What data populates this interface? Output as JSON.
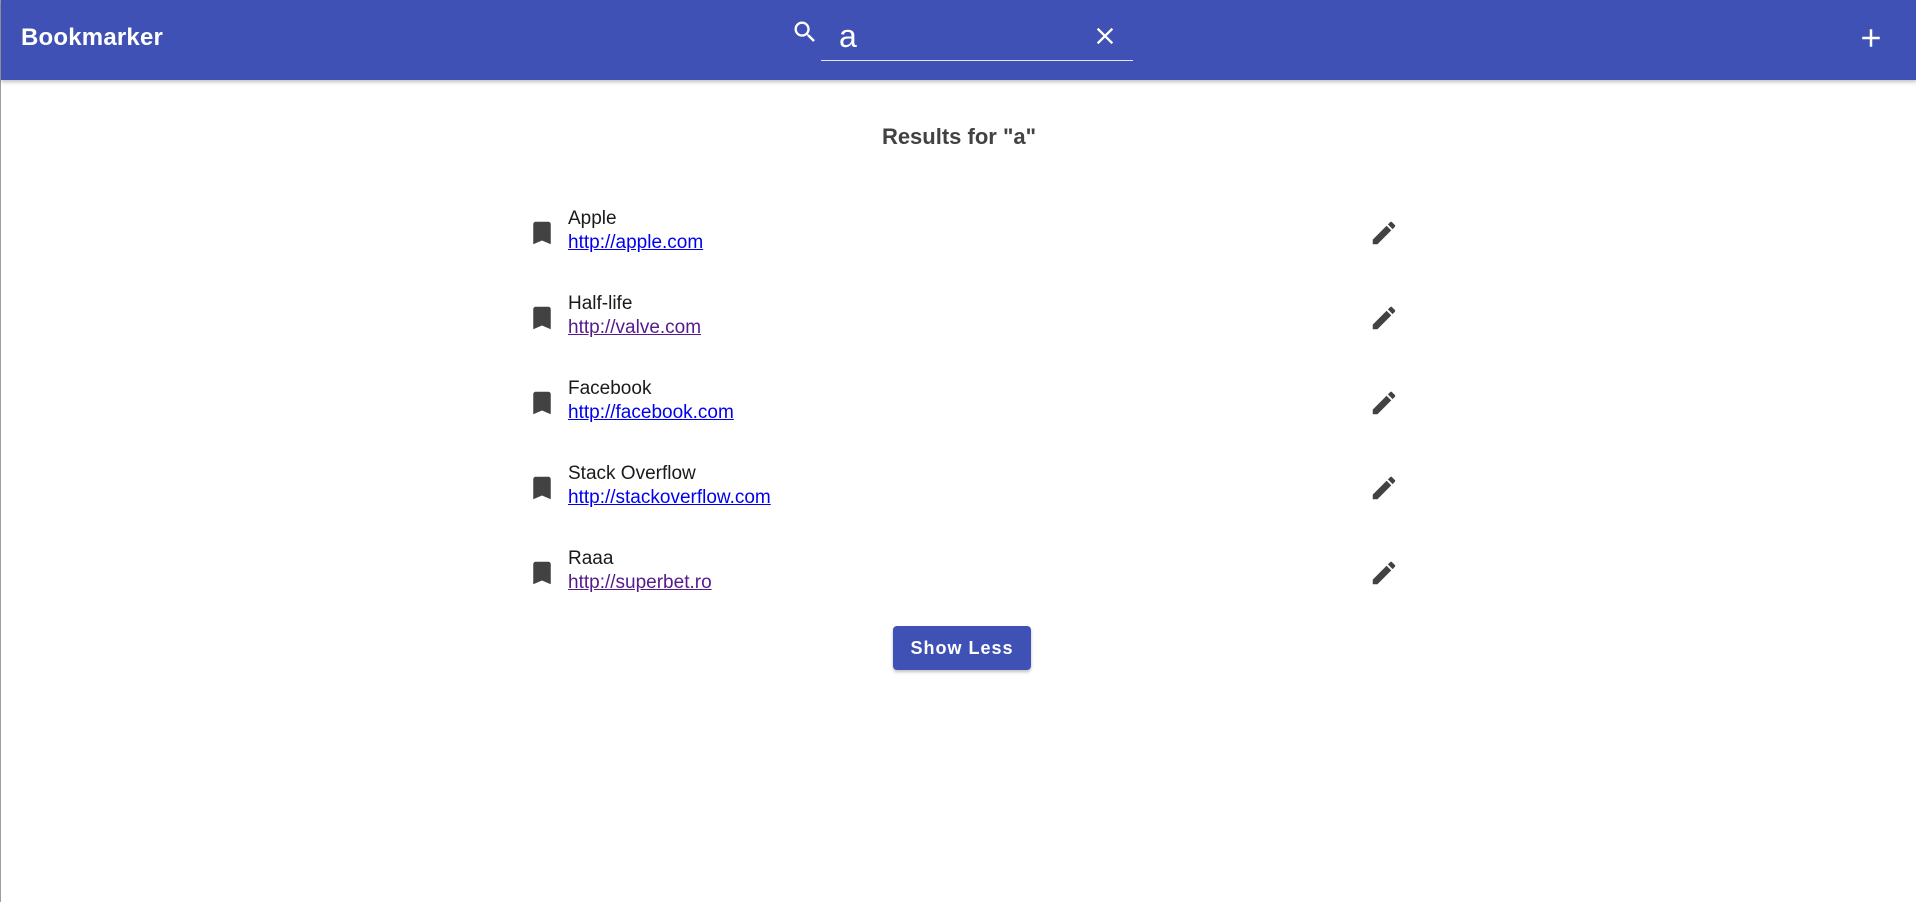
{
  "header": {
    "title": "Bookmarker",
    "search_value": "a",
    "icons": {
      "search": "search-icon",
      "clear": "close-icon",
      "add": "add-icon"
    }
  },
  "main": {
    "heading": "Results for \"a\"",
    "items": [
      {
        "title": "Apple",
        "url": "http://apple.com",
        "visited": false
      },
      {
        "title": "Half-life",
        "url": "http://valve.com",
        "visited": true
      },
      {
        "title": "Facebook",
        "url": "http://facebook.com",
        "visited": false
      },
      {
        "title": "Stack Overflow",
        "url": "http://stackoverflow.com",
        "visited": false
      },
      {
        "title": "Raaa",
        "url": "http://superbet.ro",
        "visited": true
      }
    ],
    "show_less_label": "Show Less"
  },
  "colors": {
    "primary": "#3f51b5",
    "link": "#0000ee",
    "link_visited": "#551a8b",
    "icon": "#424242"
  }
}
